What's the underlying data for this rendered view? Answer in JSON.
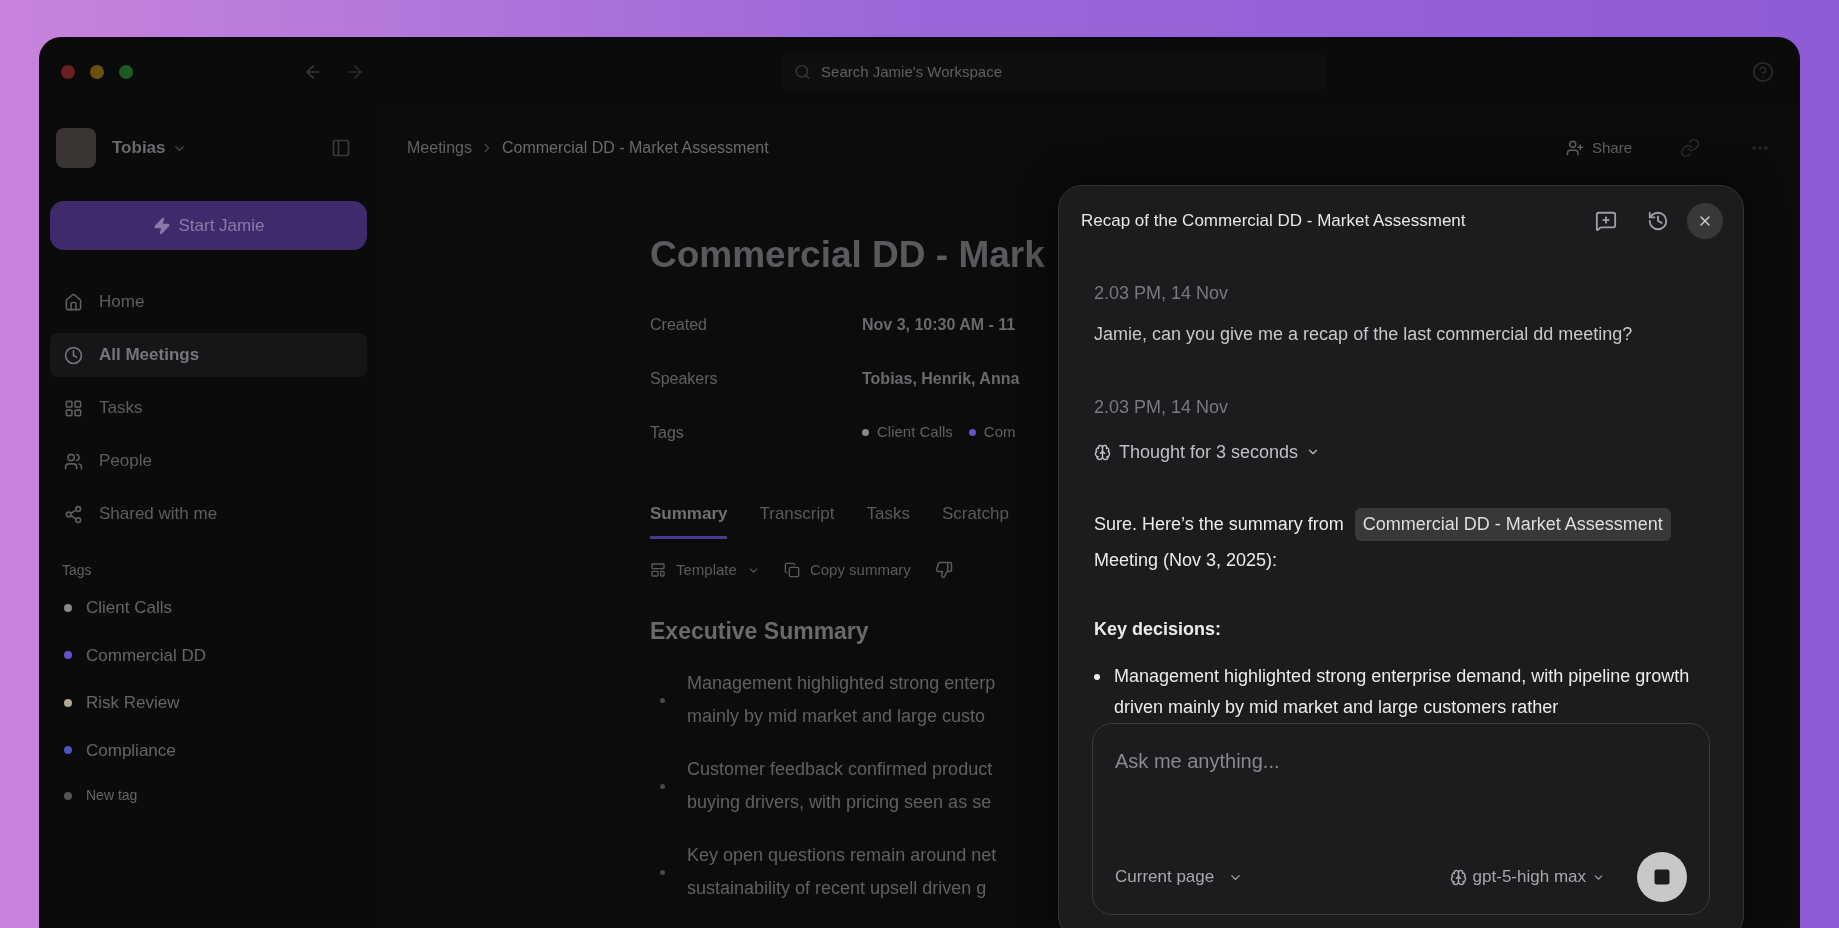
{
  "window": {
    "search_placeholder": "Search Jamie's Workspace"
  },
  "sidebar": {
    "user": "Tobias",
    "start_button": "Start Jamie",
    "items": [
      {
        "label": "Home",
        "kind": "home",
        "selected": false
      },
      {
        "label": "All Meetings",
        "kind": "meetings",
        "selected": true
      },
      {
        "label": "Tasks",
        "kind": "tasks",
        "selected": false
      },
      {
        "label": "People",
        "kind": "people",
        "selected": false
      },
      {
        "label": "Shared with me",
        "kind": "shared",
        "selected": false
      }
    ],
    "tags_heading": "Tags",
    "tags": [
      {
        "label": "Client Calls",
        "color": "#8a8a8a"
      },
      {
        "label": "Commercial DD",
        "color": "#6b4fd0"
      },
      {
        "label": "Risk Review",
        "color": "#b0a890"
      },
      {
        "label": "Compliance",
        "color": "#4a55c0"
      },
      {
        "label": "New tag",
        "color": "#555555"
      }
    ]
  },
  "breadcrumb": [
    "Meetings",
    "Commercial DD - Market Assessment"
  ],
  "header_actions": {
    "share": "Share"
  },
  "page": {
    "title": "Commercial DD - Mark",
    "properties": [
      {
        "label": "Created",
        "value": "Nov 3, 10:30 AM - 11"
      },
      {
        "label": "Speakers",
        "value": "Tobias, Henrik, Anna"
      }
    ],
    "tags_label": "Tags",
    "tags": [
      {
        "label": "Client Calls",
        "color": "#8a8a8a"
      },
      {
        "label": "Com",
        "color": "#6b4fd0"
      }
    ],
    "tabs": [
      {
        "label": "Summary",
        "selected": true
      },
      {
        "label": "Transcript",
        "selected": false
      },
      {
        "label": "Tasks",
        "selected": false
      },
      {
        "label": "Scratchp",
        "selected": false
      }
    ],
    "toolbar": {
      "template": "Template",
      "copy": "Copy summary"
    },
    "section_title": "Executive Summary",
    "bullets": [
      [
        "Management highlighted strong enterp",
        "mainly by mid market and large custo"
      ],
      [
        "Customer feedback confirmed product",
        "buying drivers, with pricing seen as se"
      ],
      [
        "Key open questions remain around net",
        "sustainability of recent upsell driven g"
      ]
    ]
  },
  "chat": {
    "title": "Recap of the Commercial DD - Market Assessment",
    "user_message": {
      "time": "2.03 PM, 14 Nov",
      "text": "Jamie, can you give me a recap of the last commercial dd meeting?"
    },
    "reply": {
      "time": "2.03 PM, 14 Nov",
      "thought": "Thought for 3 seconds",
      "intro": "Sure. Here’s the summary from",
      "chip": "Commercial DD - Market Assessment",
      "intro_end": "Meeting (Nov 3, 2025):",
      "heading": "Key decisions:",
      "bullets": [
        "Management highlighted strong enterprise demand, with pipeline growth driven mainly by mid market and large customers rather"
      ]
    },
    "input": {
      "placeholder": "Ask me anything...",
      "context": "Current page",
      "model": "gpt-5-high max"
    }
  }
}
